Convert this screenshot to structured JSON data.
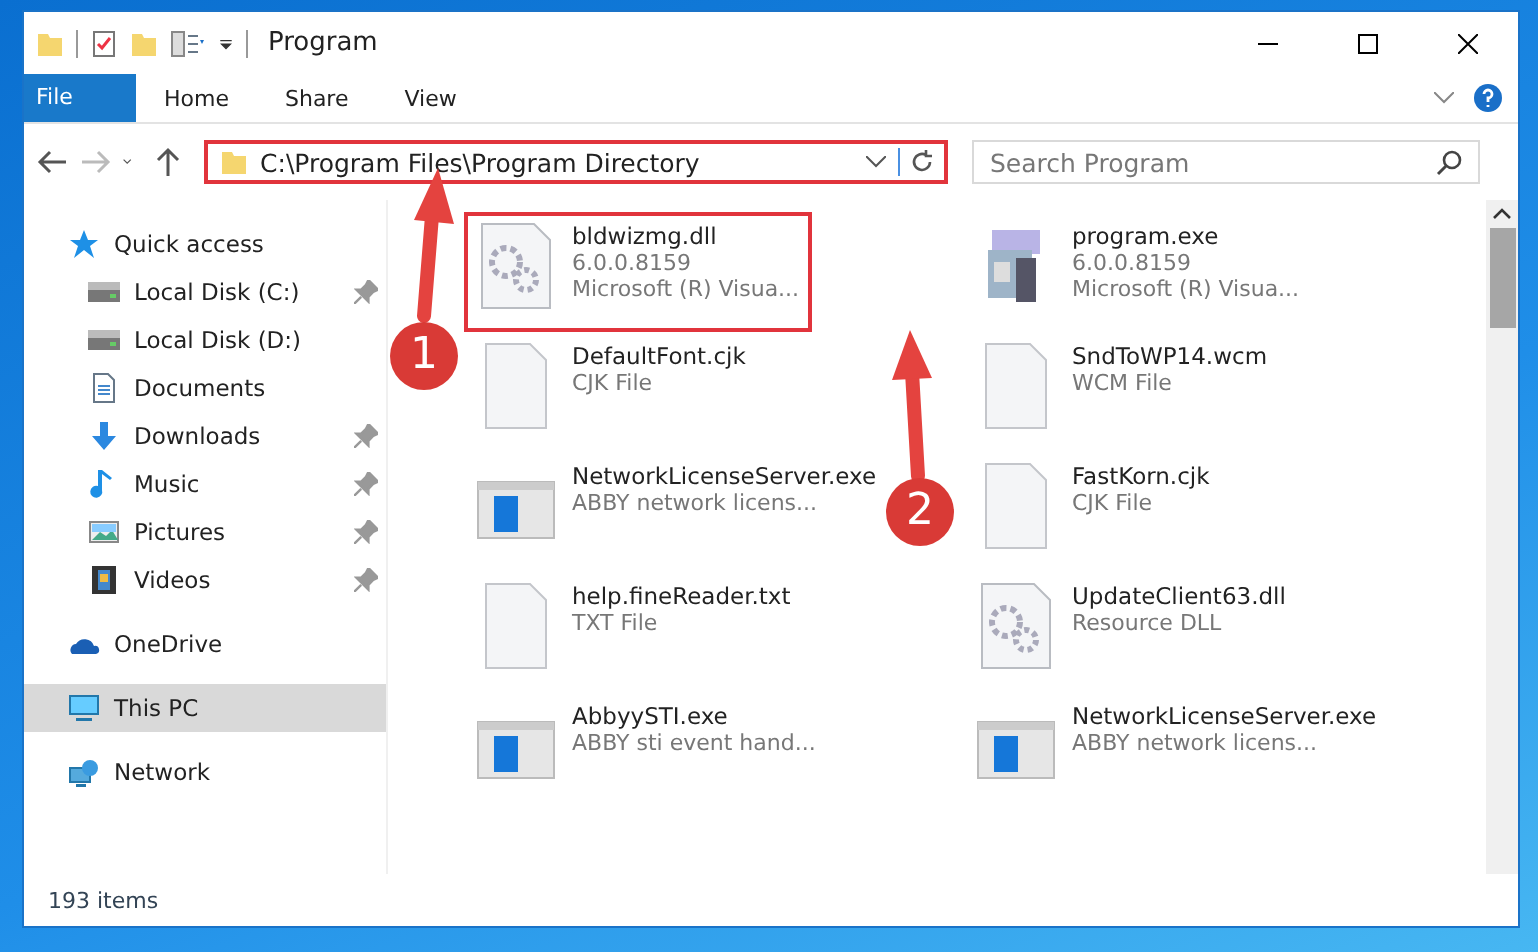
{
  "window": {
    "title": "Program"
  },
  "ribbon_tabs": [
    {
      "label": "File",
      "kind": "file"
    },
    {
      "label": "Home",
      "kind": "tab"
    },
    {
      "label": "Share",
      "kind": "tab"
    },
    {
      "label": "View",
      "kind": "tab"
    }
  ],
  "address_bar": {
    "path": "C:\\Program Files\\Program Directory",
    "highlighted": true
  },
  "search": {
    "placeholder": "Search Program"
  },
  "sidebar": {
    "items": [
      {
        "label": "Quick access",
        "kind": "star",
        "selected": false,
        "children": [
          {
            "label": "Local Disk (C:)",
            "kind": "drive",
            "pinned": true,
            "selected": false
          },
          {
            "label": "Local Disk (D:)",
            "kind": "drive",
            "pinned": false,
            "selected": false
          },
          {
            "label": "Documents",
            "kind": "document",
            "pinned": false,
            "selected": false
          },
          {
            "label": "Downloads",
            "kind": "download",
            "pinned": true,
            "selected": false
          },
          {
            "label": "Music",
            "kind": "music",
            "pinned": true,
            "selected": false
          },
          {
            "label": "Pictures",
            "kind": "pictures",
            "pinned": true,
            "selected": false
          },
          {
            "label": "Videos",
            "kind": "videos",
            "pinned": true,
            "selected": false
          }
        ]
      },
      {
        "label": "OneDrive",
        "kind": "cloud",
        "selected": false
      },
      {
        "label": "This PC",
        "kind": "pc",
        "selected": true
      },
      {
        "label": "Network",
        "kind": "network",
        "selected": false
      }
    ]
  },
  "files": [
    {
      "name": "bldwizmg.dll",
      "details": [
        "6.0.0.8159",
        "Microsoft (R) Visua..."
      ],
      "kind": "dll",
      "highlighted": true
    },
    {
      "name": "program.exe",
      "details": [
        "6.0.0.8159",
        "Microsoft (R) Visua..."
      ],
      "kind": "installer",
      "highlighted": false
    },
    {
      "name": "DefaultFont.cjk",
      "details": [
        "CJK File"
      ],
      "kind": "file",
      "highlighted": false
    },
    {
      "name": "SndToWP14.wcm",
      "details": [
        "WCM File"
      ],
      "kind": "file",
      "highlighted": false
    },
    {
      "name": "NetworkLicenseServer.exe",
      "details": [
        "ABBY network licens..."
      ],
      "kind": "app",
      "highlighted": false
    },
    {
      "name": "FastKorn.cjk",
      "details": [
        "CJK File"
      ],
      "kind": "file",
      "highlighted": false
    },
    {
      "name": "help.fineReader.txt",
      "details": [
        "TXT File"
      ],
      "kind": "file",
      "highlighted": false
    },
    {
      "name": "UpdateClient63.dll",
      "details": [
        "Resource DLL"
      ],
      "kind": "dll",
      "highlighted": false
    },
    {
      "name": "AbbyySTI.exe",
      "details": [
        "ABBY sti event hand..."
      ],
      "kind": "app",
      "highlighted": false
    },
    {
      "name": "NetworkLicenseServer.exe",
      "details": [
        "ABBY network licens..."
      ],
      "kind": "app",
      "highlighted": false
    }
  ],
  "status_bar": {
    "text": "193 items"
  },
  "callouts": [
    {
      "label": "1"
    },
    {
      "label": "2"
    }
  ]
}
